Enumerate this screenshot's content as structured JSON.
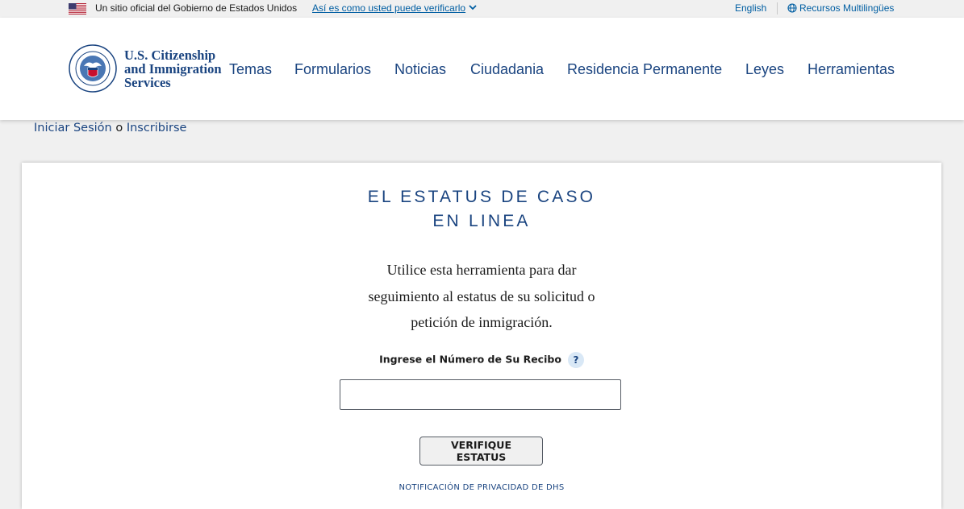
{
  "banner": {
    "official_text": "Un sitio oficial del Gobierno de Estados Unidos",
    "verify_link": "Así es como usted puede verificarlo",
    "english_link": "English",
    "multilingual_link": "Recursos Multilingües"
  },
  "header": {
    "logo_line1": "U.S. Citizenship",
    "logo_line2": "and Immigration",
    "logo_line3": "Services",
    "nav": [
      "Temas",
      "Formularios",
      "Noticias",
      "Ciudadania",
      "Residencia Permanente",
      "Leyes",
      "Herramientas"
    ]
  },
  "signin": {
    "login": "Iniciar Sesión",
    "or": "o",
    "register": "Inscribirse"
  },
  "main": {
    "title_line1": "EL ESTATUS DE CASO",
    "title_line2": "EN LINEA",
    "desc_line1": "Utilice esta herramienta para dar",
    "desc_line2": "seguimiento al estatus de su solicitud o",
    "desc_line3": "petición de inmigración.",
    "receipt_label": "Ingrese el Número de Su Recibo",
    "help_glyph": "?",
    "receipt_value": "",
    "check_button": "VERIFIQUE ESTATUS",
    "privacy_link": "NOTIFICACIÓN DE PRIVACIDAD DE DHS"
  },
  "colors": {
    "brand_navy": "#1a4480",
    "link_blue": "#005ea2",
    "page_bg": "#f0f0f0"
  },
  "icons": {
    "flag": "us-flag-icon",
    "chevron": "chevron-down-icon",
    "globe": "globe-icon",
    "seal": "dhs-seal-icon",
    "help": "help-icon"
  }
}
